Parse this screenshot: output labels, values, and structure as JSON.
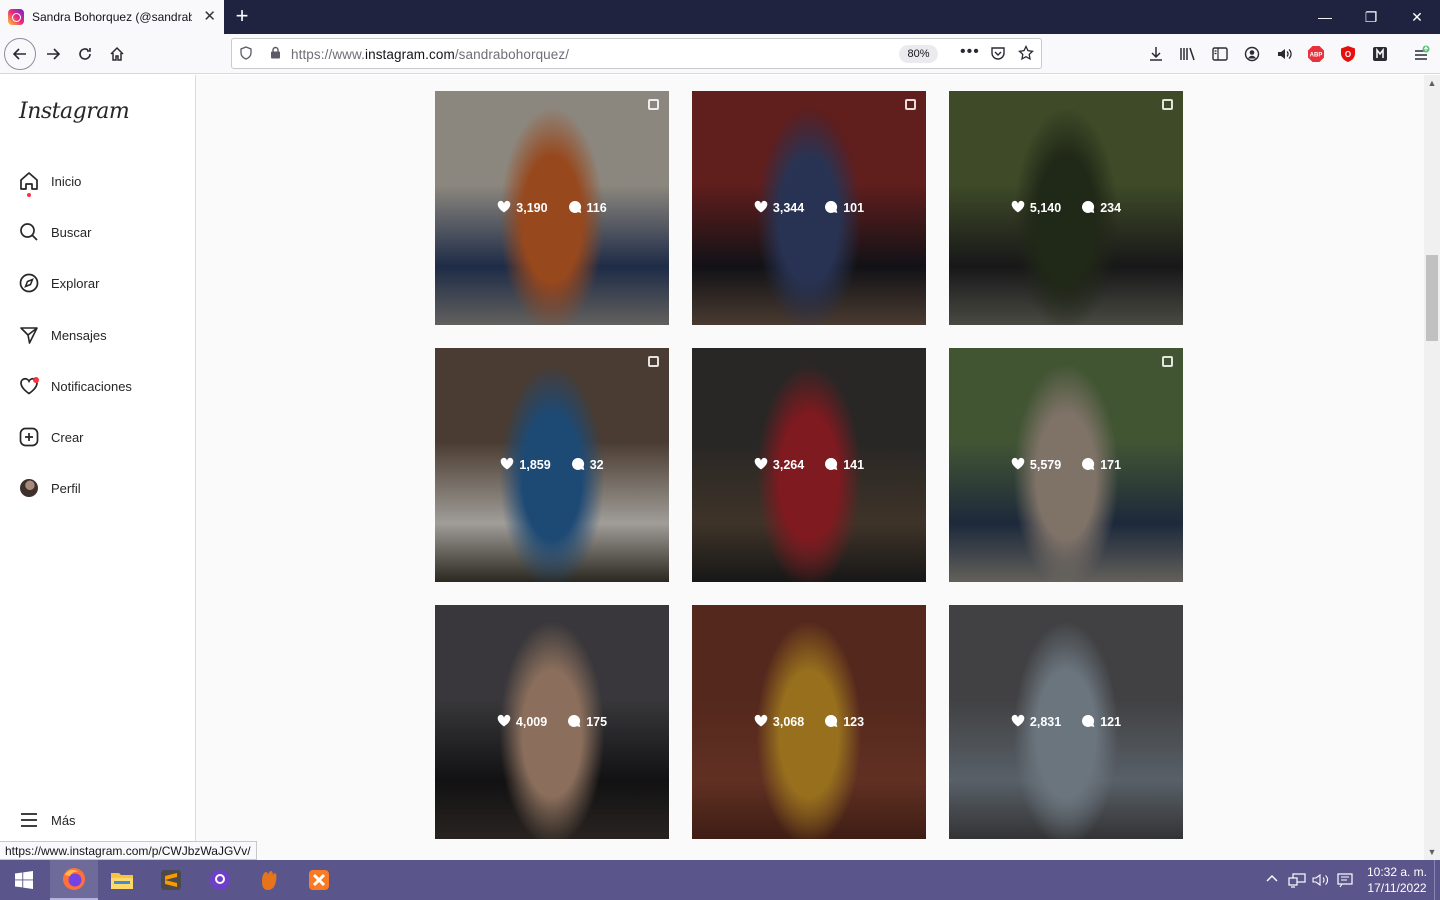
{
  "browser": {
    "tab_title": "Sandra Bohorquez (@sandrabohorquez)",
    "url_prefix": "https://www.",
    "url_domain": "instagram.com",
    "url_path": "/sandrabohorquez/",
    "zoom": "80%",
    "status_url": "https://www.instagram.com/p/CWJbzWaJGVv/"
  },
  "sidebar": {
    "logo": "Instagram",
    "items": [
      {
        "label": "Inicio",
        "icon": "home-icon"
      },
      {
        "label": "Buscar",
        "icon": "search-icon"
      },
      {
        "label": "Explorar",
        "icon": "compass-icon"
      },
      {
        "label": "Mensajes",
        "icon": "send-icon"
      },
      {
        "label": "Notificaciones",
        "icon": "heart-icon"
      },
      {
        "label": "Crear",
        "icon": "plus-square-icon"
      },
      {
        "label": "Perfil",
        "icon": "avatar"
      }
    ],
    "more_label": "Más"
  },
  "posts": [
    {
      "likes": "3,190",
      "comments": "116",
      "multi": true,
      "colors": [
        "#c9c2b5",
        "#d9672a",
        "#2c3f66",
        "#8d8a86"
      ]
    },
    {
      "likes": "3,344",
      "comments": "101",
      "multi": true,
      "colors": [
        "#8a2b2a",
        "#3a4a78",
        "#1a1a20",
        "#6a5446"
      ]
    },
    {
      "likes": "5,140",
      "comments": "234",
      "multi": true,
      "colors": [
        "#5a6b3a",
        "#2f3a22",
        "#222224",
        "#6a6a60"
      ]
    },
    {
      "likes": "1,859",
      "comments": "32",
      "multi": true,
      "colors": [
        "#6a5648",
        "#2a6aa8",
        "#e6e1da",
        "#3d3a30"
      ]
    },
    {
      "likes": "3,264",
      "comments": "141",
      "multi": false,
      "colors": [
        "#3a3836",
        "#b5262e",
        "#5a4a3a",
        "#222"
      ]
    },
    {
      "likes": "5,579",
      "comments": "171",
      "multi": true,
      "colors": [
        "#5f7a4a",
        "#b7a596",
        "#2a3b55",
        "#8d8a82"
      ]
    },
    {
      "likes": "4,009",
      "comments": "175",
      "multi": false,
      "colors": [
        "#525055",
        "#c79f84",
        "#1a1a1c",
        "#3a332f"
      ]
    },
    {
      "likes": "3,068",
      "comments": "123",
      "multi": false,
      "colors": [
        "#7a3a2a",
        "#d9a02a",
        "#8a4632",
        "#5a2a1e"
      ]
    },
    {
      "likes": "2,831",
      "comments": "121",
      "multi": false,
      "colors": [
        "#5d5d60",
        "#9aa8b5",
        "#7f8a95",
        "#4a4a4c"
      ]
    }
  ],
  "taskbar": {
    "time": "10:32 a. m.",
    "date": "17/11/2022"
  }
}
